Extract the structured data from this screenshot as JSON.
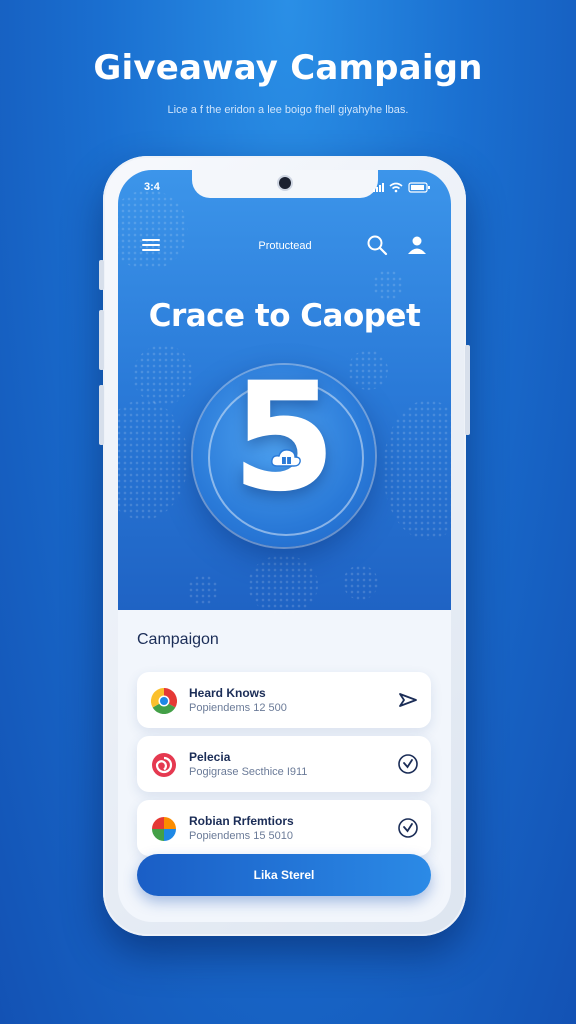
{
  "poster": {
    "title": "Giveaway Campaign",
    "subtitle": "Lice a f the eridon a lee boigo fhell giyahyhe lbas."
  },
  "status_bar": {
    "time": "3:4"
  },
  "nav": {
    "title": "Protuctead",
    "menu_icon": "hamburger-icon",
    "search_icon": "search-icon",
    "user_icon": "user-icon"
  },
  "hero": {
    "headline": "Crace to Caopet",
    "number": "5",
    "badge_icon": "cloud-gift-icon"
  },
  "campaign": {
    "section_title": "Campaigon",
    "items": [
      {
        "name": "Heard Knows",
        "sub": "Popiendems 12 500",
        "icon": "chrome-like-logo-icon",
        "action_icon": "send-arrow-icon"
      },
      {
        "name": "Pelecia",
        "sub": "Pogigrase Secthice I911",
        "icon": "swirl-logo-icon",
        "action_icon": "check-circle-icon"
      },
      {
        "name": "Robian Rrfemtiors",
        "sub": "Popiendems 15 5010",
        "icon": "colorful-logo-icon",
        "action_icon": "check-circle-icon"
      }
    ],
    "cta_label": "Lika Sterel"
  },
  "colors": {
    "brand_blue": "#1f63c4",
    "accent": "#2b8ae6",
    "text_dark": "#1b2d57"
  }
}
